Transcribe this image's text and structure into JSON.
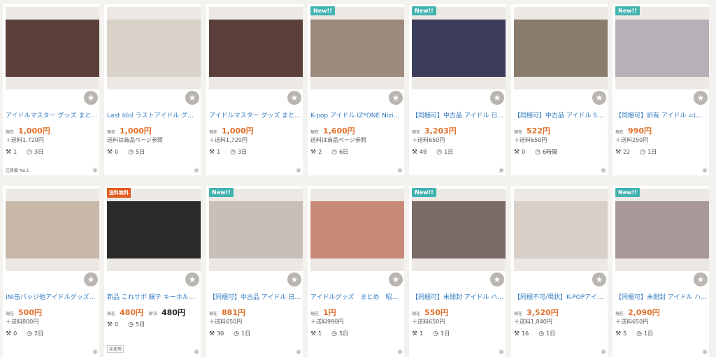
{
  "icons": {
    "star": "★",
    "bids": "⚒",
    "clock": "◷",
    "eye": "◉"
  },
  "labels": {
    "current": "現在",
    "buy_now": "即決"
  },
  "colors": {
    "new_badge": "#43b3b0",
    "ship_badge": "#e35a1c",
    "price": "#e0702a",
    "title_link": "#2f79c1",
    "background": "#f4f2ee"
  },
  "items": [
    {
      "badge": "",
      "title": "アイドルマスター グッズ まとめ売り",
      "price": "1,000円",
      "shipping": "＋送料1,720円",
      "bids": "1",
      "time": "3日",
      "note": "注目度 No.1",
      "photo_color": "#5a3f3a"
    },
    {
      "badge": "",
      "title": "Last Idol ラストアイドル グッズ (…",
      "price": "1,000円",
      "shipping": "送料は商品ページ参照",
      "bids": "0",
      "time": "5日",
      "note": "",
      "photo_color": "#d8d2c8"
    },
    {
      "badge": "",
      "title": "アイドルマスター グッズ まとめ売り",
      "price": "1,000円",
      "shipping": "＋送料1,720円",
      "bids": "1",
      "time": "3日",
      "note": "",
      "photo_color": "#5a3f3a"
    },
    {
      "badge": "New!!",
      "title": "K-pop アイドル IZ*ONE NiziU グ…",
      "price": "1,600円",
      "shipping": "送料は商品ページ参照",
      "bids": "2",
      "time": "6日",
      "note": "",
      "photo_color": "#9c8a7c"
    },
    {
      "badge": "New!!",
      "title": "【同梱可】中古品 アイドル 日向坂…",
      "price": "3,203円",
      "shipping": "＋送料650円",
      "bids": "49",
      "time": "1日",
      "note": "",
      "photo_color": "#3a3c5a"
    },
    {
      "badge": "",
      "title": "【同梱可】中古品 アイドル SEVE…",
      "price": "522円",
      "shipping": "＋送料650円",
      "bids": "0",
      "time": "6時間",
      "note": "",
      "photo_color": "#8a7c6c"
    },
    {
      "badge": "New!!",
      "title": "【同梱可】訳有 アイドル =LOVE …",
      "price": "990円",
      "shipping": "＋送料250円",
      "bids": "22",
      "time": "1日",
      "note": "",
      "photo_color": "#b8b0b8"
    },
    {
      "badge": "",
      "title": "INI缶バッジ他アイドルグッズまと…",
      "price": "500円",
      "shipping": "＋送料800円",
      "bids": "0",
      "time": "2日",
      "note": "",
      "photo_color": "#c8b8a8"
    },
    {
      "badge": "送料無料",
      "title": "新品 これサポ 銀テ キーホルダー …",
      "price": "480円",
      "buy_price": "480円",
      "shipping": "",
      "bids": "0",
      "time": "5日",
      "note": "",
      "condition": "未使用",
      "photo_color": "#2a2a2a"
    },
    {
      "badge": "New!!",
      "title": "【同梱可】中古品 アイドル 日向坂…",
      "price": "881円",
      "shipping": "＋送料650円",
      "bids": "30",
      "time": "1日",
      "note": "",
      "photo_color": "#c8c0b8"
    },
    {
      "badge": "",
      "title": "アイドルグッズ　まとめ　昭和レ…",
      "price": "1円",
      "shipping": "＋送料990円",
      "bids": "1",
      "time": "5日",
      "note": "",
      "photo_color": "#c88a78"
    },
    {
      "badge": "New!!",
      "title": "【同梱可】未開封 アイドル ハロプ…",
      "price": "550円",
      "shipping": "＋送料650円",
      "bids": "1",
      "time": "1日",
      "note": "",
      "photo_color": "#7a6a68"
    },
    {
      "badge": "",
      "title": "【同梱不可/現状】K-POPアイドル…",
      "price": "3,520円",
      "shipping": "＋送料1,840円",
      "bids": "16",
      "time": "1日",
      "note": "",
      "photo_color": "#d8d0c8"
    },
    {
      "badge": "New!!",
      "title": "【同梱可】未開封 アイドル ハロプ…",
      "price": "2,090円",
      "shipping": "＋送料650円",
      "bids": "5",
      "time": "1日",
      "note": "",
      "photo_color": "#a89898"
    }
  ]
}
